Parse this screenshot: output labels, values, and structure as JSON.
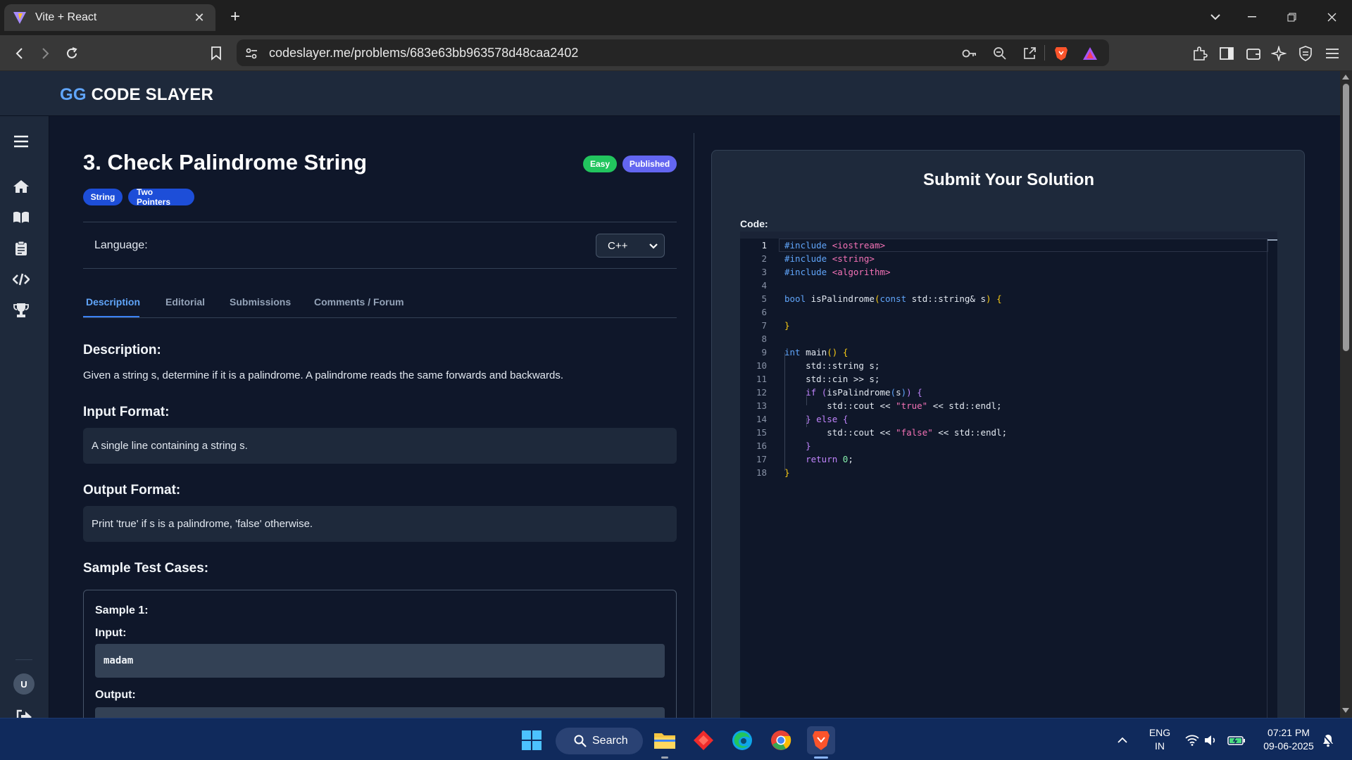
{
  "browser": {
    "tab_title": "Vite + React",
    "tab_close": "✕",
    "new_tab": "+",
    "url": "codeslayer.me/problems/683e63bb963578d48caa2402"
  },
  "app": {
    "logo_gg": "GG",
    "logo_text": "CODE SLAYER",
    "avatar_initial": "U"
  },
  "problem": {
    "title": "3. Check Palindrome String",
    "difficulty": "Easy",
    "status": "Published",
    "tags": [
      "String",
      "Two Pointers"
    ],
    "language_label": "Language:",
    "language_value": "C++",
    "tabs": [
      "Description",
      "Editorial",
      "Submissions",
      "Comments / Forum"
    ],
    "description_heading": "Description:",
    "description_text": "Given a string s, determine if it is a palindrome. A palindrome reads the same forwards and backwards.",
    "input_heading": "Input Format:",
    "input_text": "A single line containing a string s.",
    "output_heading": "Output Format:",
    "output_text": "Print 'true' if s is a palindrome, 'false' otherwise.",
    "samples_heading": "Sample Test Cases:",
    "sample1_label": "Sample 1:",
    "sample_input_label": "Input:",
    "sample1_input": "madam",
    "sample_output_label": "Output:"
  },
  "submit": {
    "title": "Submit Your Solution",
    "code_label": "Code:",
    "line_numbers": [
      "1",
      "2",
      "3",
      "4",
      "5",
      "6",
      "7",
      "8",
      "9",
      "10",
      "11",
      "12",
      "13",
      "14",
      "15",
      "16",
      "17",
      "18"
    ]
  },
  "taskbar": {
    "search": "Search",
    "lang_top": "ENG",
    "lang_bottom": "IN",
    "time": "07:21 PM",
    "date": "09-06-2025"
  },
  "colors": {
    "easy": "#22c55e",
    "published": "#6366f1",
    "accent": "#60a5fa",
    "code_keyword": "#60a5fa",
    "code_string": "#f472b6",
    "code_bracket": "#facc15"
  }
}
